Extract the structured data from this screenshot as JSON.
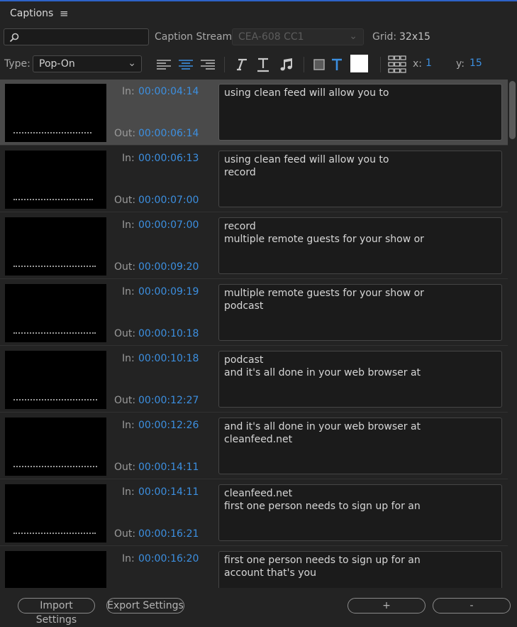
{
  "panel": {
    "title": "Captions"
  },
  "toolbar": {
    "search_placeholder": "",
    "caption_stream_label": "Caption Stream:",
    "caption_stream_value": "CEA-608 CC1",
    "grid_label": "Grid:",
    "grid_value": "32x15",
    "type_label": "Type:",
    "type_value": "Pop-On",
    "x_label": "x:",
    "x_value": "1",
    "y_label": "y:",
    "y_value": "15",
    "icons": [
      "align-left-icon",
      "align-center-icon",
      "align-right-icon",
      "italic-icon",
      "underline-icon",
      "music-note-icon",
      "background-color-icon",
      "text-color-icon",
      "color-swatch",
      "position-grid-icon"
    ],
    "colors": {
      "accent": "#3c8fe0",
      "swatch": "#ffffff"
    }
  },
  "captions": [
    {
      "in_label": "In:",
      "in": "00:00:04:14",
      "out_label": "Out:",
      "out": "00:00:06:14",
      "lines": [
        "using clean feed will allow you to"
      ],
      "selected": true
    },
    {
      "in_label": "In:",
      "in": "00:00:06:13",
      "out_label": "Out:",
      "out": "00:00:07:00",
      "lines": [
        "using clean feed will allow you to",
        "record"
      ]
    },
    {
      "in_label": "In:",
      "in": "00:00:07:00",
      "out_label": "Out:",
      "out": "00:00:09:20",
      "lines": [
        "record",
        "multiple remote guests for your show or"
      ]
    },
    {
      "in_label": "In:",
      "in": "00:00:09:19",
      "out_label": "Out:",
      "out": "00:00:10:18",
      "lines": [
        "multiple remote guests for your show or",
        "podcast"
      ]
    },
    {
      "in_label": "In:",
      "in": "00:00:10:18",
      "out_label": "Out:",
      "out": "00:00:12:27",
      "lines": [
        "podcast",
        "and it's all done in your web browser at"
      ]
    },
    {
      "in_label": "In:",
      "in": "00:00:12:26",
      "out_label": "Out:",
      "out": "00:00:14:11",
      "lines": [
        "and it's all done in your web browser at",
        "cleanfeed.net"
      ]
    },
    {
      "in_label": "In:",
      "in": "00:00:14:11",
      "out_label": "Out:",
      "out": "00:00:16:21",
      "lines": [
        "cleanfeed.net",
        "first one person needs to sign up for an"
      ]
    },
    {
      "in_label": "In:",
      "in": "00:00:16:20",
      "out_label": "Out:",
      "out": "",
      "lines": [
        "first one person needs to sign up for an",
        "account that's you"
      ]
    }
  ],
  "footer": {
    "import_label": "Import Settings",
    "export_label": "Export Settings",
    "add_label": "+",
    "remove_label": "-"
  }
}
